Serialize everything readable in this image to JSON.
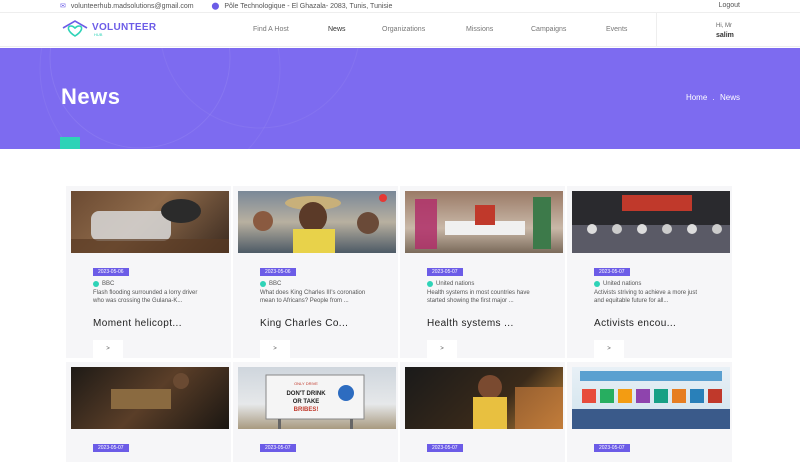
{
  "topbar": {
    "email": "volunteerhub.madsolutions@gmail.com",
    "address": "Pôle Technologique - El Ghazala- 2083, Tunis, Tunisie",
    "logout": "Logout"
  },
  "brand": {
    "name": "VOLUNTEER",
    "sub": "HUB"
  },
  "nav": {
    "items": [
      "Find A Host",
      "News",
      "Organizations",
      "Missions",
      "Campaigns",
      "Events"
    ]
  },
  "user": {
    "greeting": "Hi, Mr",
    "name": "salim"
  },
  "hero": {
    "title": "News",
    "crumb_home": "Home",
    "crumb_sep": ".",
    "crumb_current": "News"
  },
  "cards": [
    {
      "date": "2023-05-06",
      "source": "BBC",
      "desc": "Flash flooding surrounded a lorry driver who was crossing the Gulana-K...",
      "title": "Moment helicopt...",
      "more": ">"
    },
    {
      "date": "2023-05-06",
      "source": "BBC",
      "desc": "What does King Charles III's coronation mean to Africans? People from ...",
      "title": "King Charles Co...",
      "more": ">"
    },
    {
      "date": "2023-05-07",
      "source": "United nations",
      "desc": "Health systems in most countries have started showing the first major ...",
      "title": "Health systems ...",
      "more": ">"
    },
    {
      "date": "2023-05-07",
      "source": "United nations",
      "desc": "Activists striving to achieve a more just and equitable future for all...",
      "title": "Activists encou...",
      "more": ">"
    },
    {
      "date": "2023-05-07",
      "source": "",
      "desc": "",
      "title": "",
      "more": ""
    },
    {
      "date": "2023-05-07",
      "source": "",
      "desc": "",
      "title": "",
      "more": ""
    },
    {
      "date": "2023-05-07",
      "source": "",
      "desc": "",
      "title": "",
      "more": ""
    },
    {
      "date": "2023-05-07",
      "source": "",
      "desc": "",
      "title": "",
      "more": ""
    }
  ],
  "billboard_text": [
    "ONLY DRIVE",
    "DON'T DRINK",
    "OR TAKE",
    "BRIBES!"
  ],
  "colors": {
    "accent": "#6c5ce7",
    "hero_bg": "#7d6bf0",
    "teal": "#2ed3b7"
  }
}
